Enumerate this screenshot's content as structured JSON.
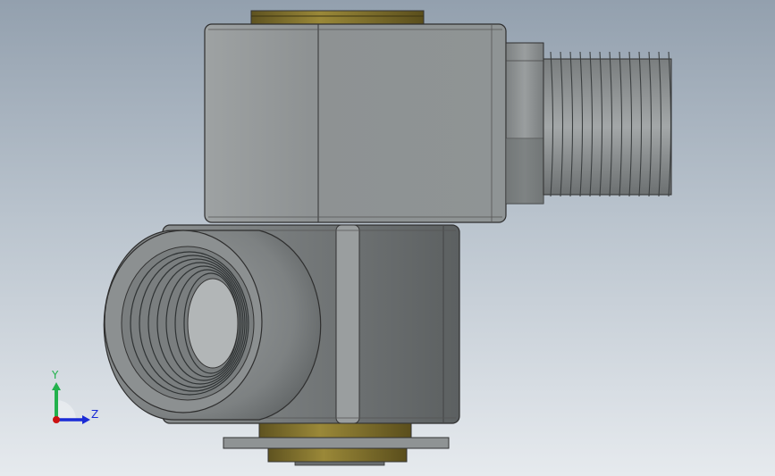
{
  "viewport": {
    "background_top": "#93a0ae",
    "background_bottom": "#e6eaee"
  },
  "triad": {
    "y_label": "Y",
    "z_label": "Z",
    "y_color": "#22b14c",
    "z_color": "#1a2bd6",
    "x_color": "#cc1111"
  },
  "model": {
    "body_color": "#8c9192",
    "washer_color": "#7a6a28",
    "thread_color": "#8f9394"
  }
}
